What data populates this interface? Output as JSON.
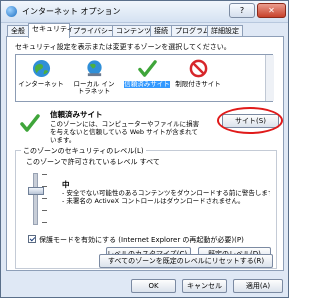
{
  "window": {
    "title": "インターネット オプション",
    "help": "?",
    "close": "✕"
  },
  "tabs": [
    "全般",
    "セキュリティ",
    "プライバシー",
    "コンテンツ",
    "接続",
    "プログラム",
    "詳細設定"
  ],
  "security": {
    "instruction": "セキュリティ設定を表示または変更するゾーンを選択してください。",
    "zones": [
      {
        "label": "インターネット",
        "icon": "globe-icon"
      },
      {
        "label": "ローカル イントラネット",
        "icon": "intranet-globe-icon"
      },
      {
        "label": "信頼済みサイト",
        "icon": "green-check-icon"
      },
      {
        "label": "制限付きサイト",
        "icon": "no-entry-icon"
      }
    ],
    "selected_zone": {
      "name": "信頼済みサイト",
      "description": "このゾーンには、コンピューターやファイルに損害を与えないと信頼している Web サイトが含まれています。"
    },
    "sites_button": "サイト(S)",
    "level_group": {
      "legend": "このゾーンのセキュリティのレベル(L)",
      "allowed": "このゾーンで許可されているレベル すべて",
      "level": "中",
      "desc": [
        "- 安全でない可能性のあるコンテンツをダウンロードする前に警告します",
        "- 未署名の ActiveX コントロールはダウンロードされません。"
      ],
      "protected_mode": "保護モードを有効にする (Internet Explorer の再起動が必要)(P)",
      "custom_level_button": "レベルのカスタマイズ(C)...",
      "default_level_button": "既定のレベル(D)"
    },
    "reset_all_button": "すべてのゾーンを既定のレベルにリセットする(R)"
  },
  "footer": {
    "ok": "OK",
    "cancel": "キャンセル",
    "apply": "適用(A)"
  },
  "colors": {
    "highlight": "#3399ff",
    "annotation_ring": "#e01a1a",
    "check_green": "#3fa53a"
  }
}
